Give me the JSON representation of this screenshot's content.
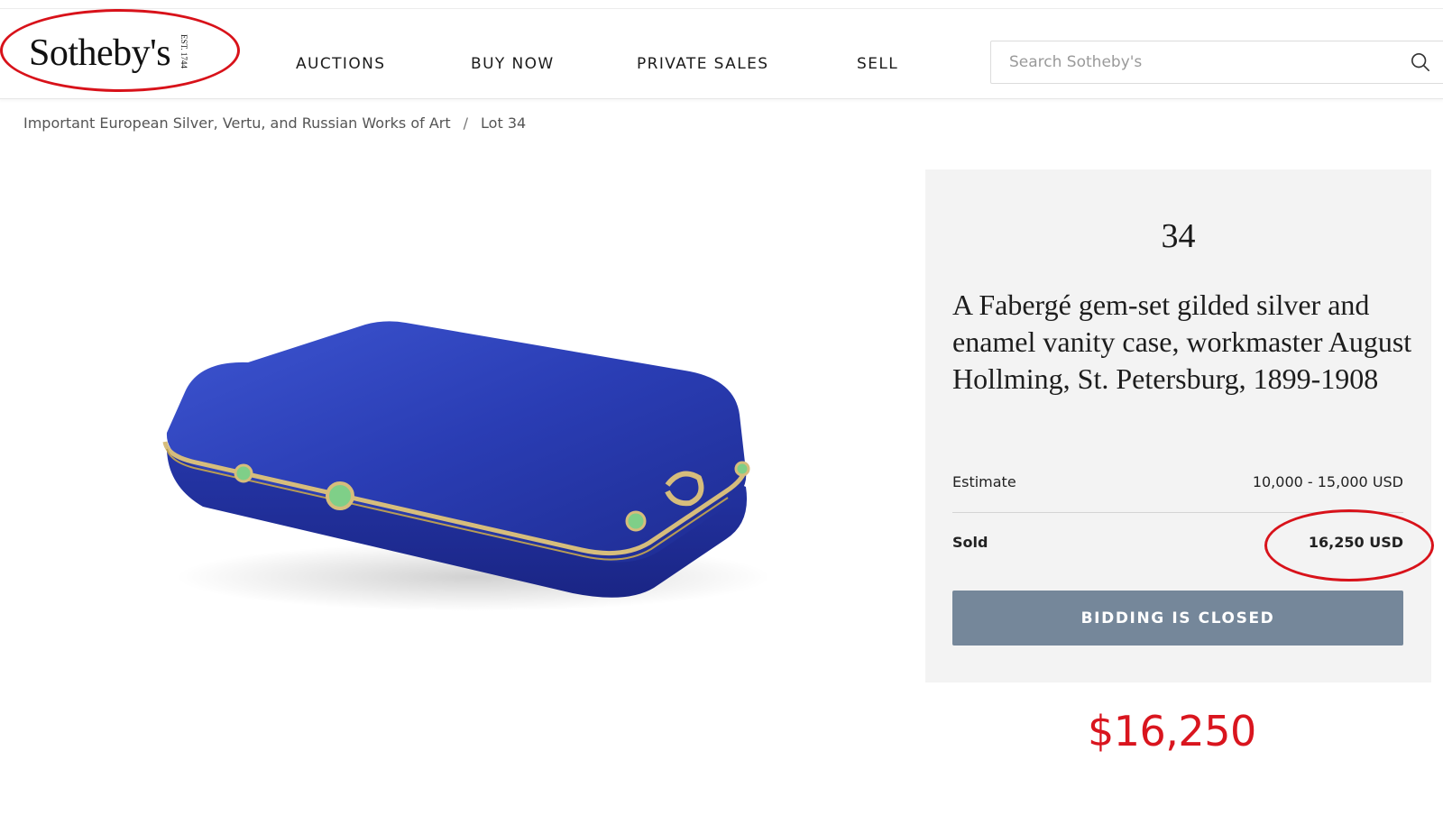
{
  "header": {
    "logo_text": "Sotheby's",
    "logo_est": "EST. 1744",
    "nav": [
      "AUCTIONS",
      "BUY NOW",
      "PRIVATE SALES",
      "SELL"
    ],
    "search_placeholder": "Search Sotheby's",
    "search_icon": "search-icon"
  },
  "breadcrumb": {
    "sale": "Important European Silver, Vertu, and Russian Works of Art",
    "separator": "/",
    "lot": "Lot 34"
  },
  "product": {
    "image": "blue enamel vanity case",
    "colors": {
      "enamel": "#2b3fb3",
      "gold": "#d6bd7c",
      "gem": "#7fcf88"
    }
  },
  "panel": {
    "lot_number": "34",
    "title": "A Fabergé gem-set gilded silver and enamel vanity case, workmaster August Hollming, St. Petersburg, 1899-1908",
    "estimate_label": "Estimate",
    "estimate_value": "10,000 - 15,000 USD",
    "sold_label": "Sold",
    "sold_value": "16,250 USD",
    "button_label": "BIDDING IS CLOSED"
  },
  "annotation": {
    "price": "$16,250",
    "color": "#d9151e"
  }
}
